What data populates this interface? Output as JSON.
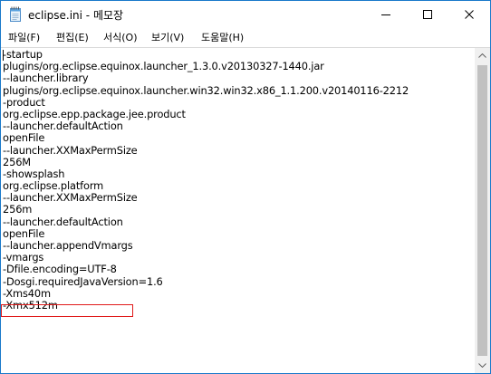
{
  "window": {
    "title": "eclipse.ini - 메모장",
    "icon": "notepad-icon",
    "controls": {
      "minimize": "minimize-icon",
      "maximize": "maximize-icon",
      "close": "close-icon"
    }
  },
  "menu": {
    "items": [
      {
        "label": "파일(F)"
      },
      {
        "label": "편집(E)"
      },
      {
        "label": "서식(O)"
      },
      {
        "label": "보기(V)"
      },
      {
        "label": "도움말(H)"
      }
    ]
  },
  "editor": {
    "lines": [
      "-startup",
      "plugins/org.eclipse.equinox.launcher_1.3.0.v20130327-1440.jar",
      "--launcher.library",
      "plugins/org.eclipse.equinox.launcher.win32.win32.x86_1.1.200.v20140116-2212",
      "-product",
      "org.eclipse.epp.package.jee.product",
      "--launcher.defaultAction",
      "openFile",
      "--launcher.XXMaxPermSize",
      "256M",
      "-showsplash",
      "org.eclipse.platform",
      "--launcher.XXMaxPermSize",
      "256m",
      "--launcher.defaultAction",
      "openFile",
      "--launcher.appendVmargs",
      "-vmargs",
      "-Dfile.encoding=UTF-8",
      "-Dosgi.requiredJavaVersion=1.6",
      "-Xms40m",
      "-Xmx512m"
    ],
    "highlighted_line": "-Dfile.encoding=UTF-8",
    "highlight_color": "#e01a1a"
  },
  "colors": {
    "window_border": "#1979ca",
    "scrollbar_track": "#f0f0f0",
    "scrollbar_thumb": "#c1c1c1"
  }
}
